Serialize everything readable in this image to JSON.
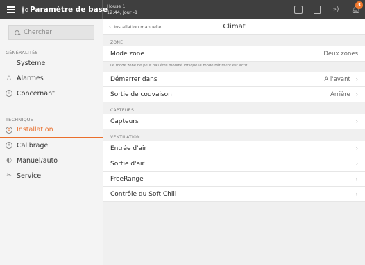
{
  "topbar": {
    "title": "Paramètre de base",
    "house_name": "House 1",
    "house_time": "12:44, Jour -1",
    "alarm_count": "3",
    "icons": [
      "menu-icon",
      "gear-icon",
      "home-icon",
      "document-icon",
      "signal-icon",
      "bell-icon"
    ]
  },
  "sidebar": {
    "search_placeholder": "Chercher",
    "section_general": "GÉNÉRALITÉS",
    "section_technique": "TECHNIQUE",
    "items": [
      {
        "label": "Système",
        "icon": "system-icon"
      },
      {
        "label": "Alarmes",
        "icon": "bell-icon"
      },
      {
        "label": "Concernant",
        "icon": "info-icon"
      },
      {
        "label": "Installation",
        "icon": "installation-icon",
        "active": true
      },
      {
        "label": "Calibrage",
        "icon": "calibration-icon"
      },
      {
        "label": "Manuel/auto",
        "icon": "toggle-icon"
      },
      {
        "label": "Service",
        "icon": "tools-icon"
      }
    ]
  },
  "main": {
    "breadcrumb": "Installation manuelle",
    "title": "Climat",
    "group_zone": "ZONE",
    "group_sensors": "CAPTEURS",
    "group_ventilation": "VENTILATION",
    "zone_note": "Le mode zone ne peut pas être modifié lorsque le mode bâtiment est actif",
    "rows": {
      "mode_zone": {
        "label": "Mode zone",
        "value": "Deux zones"
      },
      "start_in": {
        "label": "Démarrer dans",
        "value": "A l'avant"
      },
      "brood_exit": {
        "label": "Sortie de couvaison",
        "value": "Arrière"
      },
      "sensors": {
        "label": "Capteurs"
      },
      "air_in": {
        "label": "Entrée d'air"
      },
      "air_out": {
        "label": "Sortie d'air"
      },
      "freerange": {
        "label": "FreeRange"
      },
      "soft_chill": {
        "label": "Contrôle du Soft Chill"
      }
    }
  },
  "colors": {
    "accent": "#ea6f2c",
    "topbar": "#3f3f3f"
  }
}
